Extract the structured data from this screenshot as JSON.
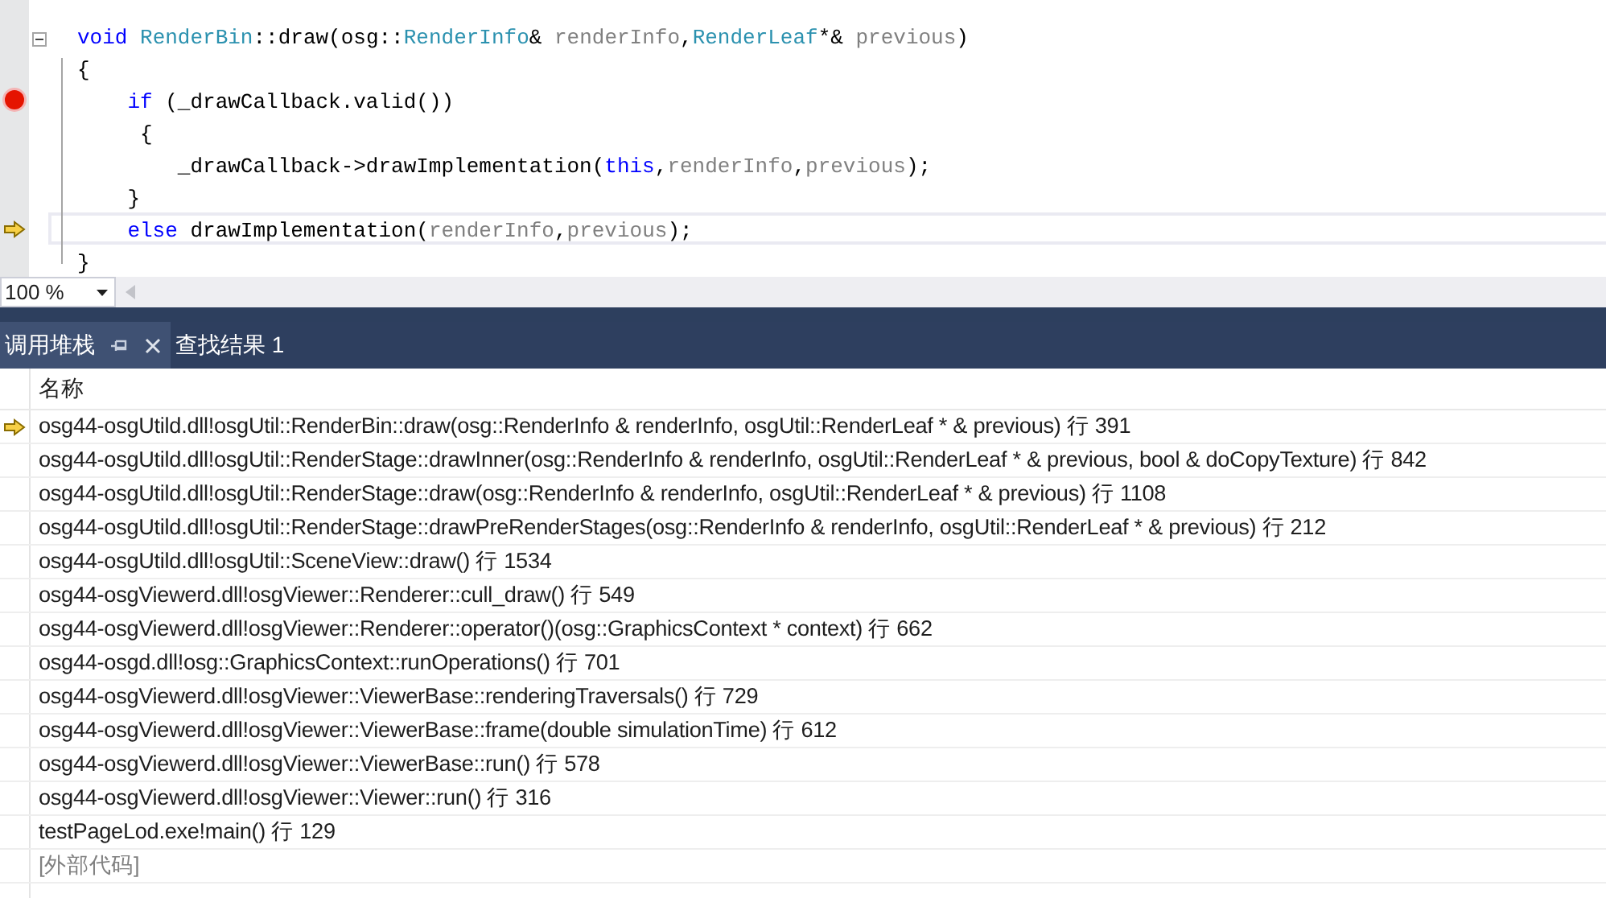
{
  "editor": {
    "lines": [
      {
        "breakpoint": false,
        "current": false,
        "highlighted": false,
        "tokens": [
          {
            "kind": "keyword",
            "text": "void"
          },
          {
            "kind": "type",
            "text": " RenderBin"
          },
          {
            "kind": "plain",
            "text": "::draw(osg::"
          },
          {
            "kind": "type",
            "text": "RenderInfo"
          },
          {
            "kind": "plain",
            "text": "& "
          },
          {
            "kind": "param",
            "text": "renderInfo"
          },
          {
            "kind": "plain",
            "text": ","
          },
          {
            "kind": "type",
            "text": "RenderLeaf"
          },
          {
            "kind": "plain",
            "text": "*& "
          },
          {
            "kind": "param",
            "text": "previous"
          },
          {
            "kind": "plain",
            "text": ")"
          }
        ]
      },
      {
        "breakpoint": false,
        "current": false,
        "highlighted": false,
        "tokens": [
          {
            "kind": "plain",
            "text": "{"
          }
        ]
      },
      {
        "breakpoint": true,
        "current": false,
        "highlighted": false,
        "tokens": [
          {
            "kind": "keyword",
            "text": "    if"
          },
          {
            "kind": "plain",
            "text": " (_drawCallback.valid())"
          }
        ]
      },
      {
        "breakpoint": false,
        "current": false,
        "highlighted": false,
        "tokens": [
          {
            "kind": "plain",
            "text": "     {"
          }
        ]
      },
      {
        "breakpoint": false,
        "current": false,
        "highlighted": false,
        "tokens": [
          {
            "kind": "plain",
            "text": "        _drawCallback->drawImplementation("
          },
          {
            "kind": "keyword",
            "text": "this"
          },
          {
            "kind": "plain",
            "text": ","
          },
          {
            "kind": "param",
            "text": "renderInfo"
          },
          {
            "kind": "plain",
            "text": ","
          },
          {
            "kind": "param",
            "text": "previous"
          },
          {
            "kind": "plain",
            "text": ");"
          }
        ]
      },
      {
        "breakpoint": false,
        "current": false,
        "highlighted": false,
        "tokens": [
          {
            "kind": "plain",
            "text": "    }"
          }
        ]
      },
      {
        "breakpoint": false,
        "current": true,
        "highlighted": true,
        "tokens": [
          {
            "kind": "keyword",
            "text": "    else"
          },
          {
            "kind": "plain",
            "text": " drawImplementation("
          },
          {
            "kind": "param",
            "text": "renderInfo"
          },
          {
            "kind": "plain",
            "text": ","
          },
          {
            "kind": "param",
            "text": "previous"
          },
          {
            "kind": "plain",
            "text": ");"
          }
        ]
      },
      {
        "breakpoint": false,
        "current": false,
        "highlighted": false,
        "tokens": [
          {
            "kind": "plain",
            "text": "}"
          }
        ]
      }
    ],
    "zoom": "100 %"
  },
  "panel": {
    "tabs": [
      {
        "label": "调用堆栈",
        "selected": true
      },
      {
        "label": "查找结果 1",
        "selected": false
      }
    ],
    "column": "名称",
    "frames": [
      {
        "kind": "frame",
        "current": true,
        "text": "osg44-osgUtild.dll!osgUtil::RenderBin::draw(osg::RenderInfo & renderInfo, osgUtil::RenderLeaf * & previous) 行 391"
      },
      {
        "kind": "frame",
        "current": false,
        "text": "osg44-osgUtild.dll!osgUtil::RenderStage::drawInner(osg::RenderInfo & renderInfo, osgUtil::RenderLeaf * & previous, bool & doCopyTexture) 行 842"
      },
      {
        "kind": "frame",
        "current": false,
        "text": "osg44-osgUtild.dll!osgUtil::RenderStage::draw(osg::RenderInfo & renderInfo, osgUtil::RenderLeaf * & previous) 行 1108"
      },
      {
        "kind": "frame",
        "current": false,
        "text": "osg44-osgUtild.dll!osgUtil::RenderStage::drawPreRenderStages(osg::RenderInfo & renderInfo, osgUtil::RenderLeaf * & previous) 行 212"
      },
      {
        "kind": "frame",
        "current": false,
        "text": "osg44-osgUtild.dll!osgUtil::SceneView::draw() 行 1534"
      },
      {
        "kind": "frame",
        "current": false,
        "text": "osg44-osgViewerd.dll!osgViewer::Renderer::cull_draw() 行 549"
      },
      {
        "kind": "frame",
        "current": false,
        "text": "osg44-osgViewerd.dll!osgViewer::Renderer::operator()(osg::GraphicsContext * context) 行 662"
      },
      {
        "kind": "frame",
        "current": false,
        "text": "osg44-osgd.dll!osg::GraphicsContext::runOperations() 行 701"
      },
      {
        "kind": "frame",
        "current": false,
        "text": "osg44-osgViewerd.dll!osgViewer::ViewerBase::renderingTraversals() 行 729"
      },
      {
        "kind": "frame",
        "current": false,
        "text": "osg44-osgViewerd.dll!osgViewer::ViewerBase::frame(double simulationTime) 行 612"
      },
      {
        "kind": "frame",
        "current": false,
        "text": "osg44-osgViewerd.dll!osgViewer::ViewerBase::run() 行 578"
      },
      {
        "kind": "frame",
        "current": false,
        "text": "osg44-osgViewerd.dll!osgViewer::Viewer::run() 行 316"
      },
      {
        "kind": "frame",
        "current": false,
        "text": "testPageLod.exe!main() 行 129"
      },
      {
        "kind": "external",
        "current": false,
        "text": "[外部代码]"
      }
    ]
  }
}
